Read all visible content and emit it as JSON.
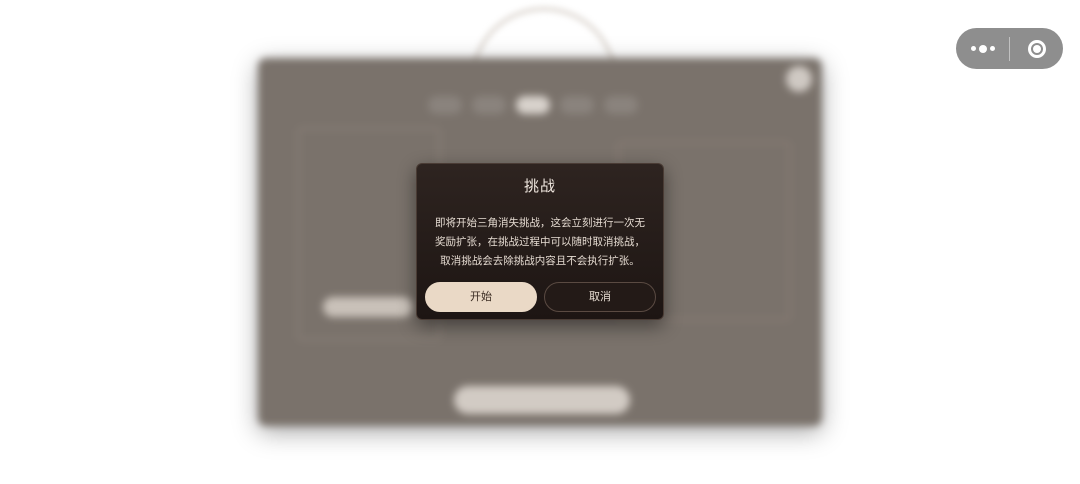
{
  "modal": {
    "title": "挑战",
    "body": "即将开始三角消失挑战，这会立刻进行一次无\n奖励扩张，在挑战过程中可以随时取消挑战，\n取消挑战会去除挑战内容且不会执行扩张。",
    "start_label": "开始",
    "cancel_label": "取消"
  },
  "capsule": {
    "more_icon": "more-dots-icon",
    "close_icon": "target-circle-icon"
  },
  "colors": {
    "modal_bg": "#241b18",
    "primary_button": "#ead9c6",
    "overlay_panel": "#7a726b"
  }
}
